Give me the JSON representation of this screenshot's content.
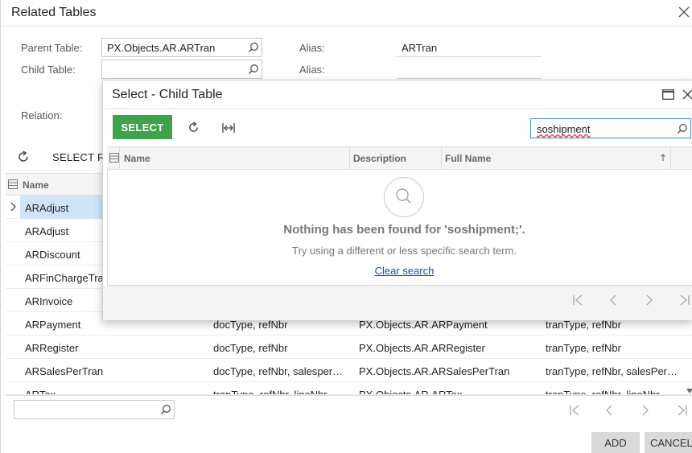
{
  "dialog": {
    "title": "Related Tables",
    "parent_table_label": "Parent Table:",
    "parent_table_value": "PX.Objects.AR.ARTran",
    "alias_label_1": "Alias:",
    "alias_value_1": "ARTran",
    "child_table_label": "Child Table:",
    "child_table_value": "",
    "alias_label_2": "Alias:",
    "relation_label": "Relation:",
    "select_label_partial": "SELECT R",
    "grid_header_name": "Name",
    "rows": [
      {
        "name": "ARAdjust",
        "keys": "",
        "full": "",
        "parent_keys": ""
      },
      {
        "name": "ARAdjust",
        "keys": "",
        "full": "",
        "parent_keys": ""
      },
      {
        "name": "ARDiscount",
        "keys": "",
        "full": "",
        "parent_keys": ""
      },
      {
        "name": "ARFinChargeTra",
        "keys": "",
        "full": "",
        "parent_keys": ""
      },
      {
        "name": "ARInvoice",
        "keys": "",
        "full": "",
        "parent_keys": ""
      },
      {
        "name": "ARPayment",
        "keys": "docType, refNbr",
        "full": "PX.Objects.AR.ARPayment",
        "parent_keys": "tranType, refNbr"
      },
      {
        "name": "ARRegister",
        "keys": "docType, refNbr",
        "full": "PX.Objects.AR.ARRegister",
        "parent_keys": "tranType, refNbr"
      },
      {
        "name": "ARSalesPerTran",
        "keys": "docType, refNbr, salesper…",
        "full": "PX.Objects.AR.ARSalesPerTran",
        "parent_keys": "tranType, refNbr, salesPer…"
      },
      {
        "name": "ARTax",
        "keys": "tranType, refNbr, lineNbr",
        "full": "PX.Objects.AR.ARTax",
        "parent_keys": "tranType, refNbr, lineNbr"
      }
    ],
    "add_label": "ADD",
    "cancel_label": "CANCEL"
  },
  "child_dialog": {
    "title": "Select - Child Table",
    "select_button": "SELECT",
    "search_value": "soshipment",
    "col_name": "Name",
    "col_description": "Description",
    "col_full_name": "Full Name",
    "empty_title": "Nothing has been found for 'soshipment;'.",
    "empty_hint": "Try using a different or less specific search term.",
    "clear_search": "Clear search"
  },
  "colors": {
    "accent_green": "#3ea34a",
    "selected_row": "#cfe4f7",
    "link_blue": "#1a4fa0"
  },
  "icons": [
    "close-icon",
    "search-icon",
    "refresh-icon",
    "fit-columns-icon",
    "maximize-icon",
    "first-page-icon",
    "prev-page-icon",
    "next-page-icon",
    "last-page-icon",
    "column-config-icon",
    "sort-asc-icon",
    "expand-row-icon"
  ]
}
